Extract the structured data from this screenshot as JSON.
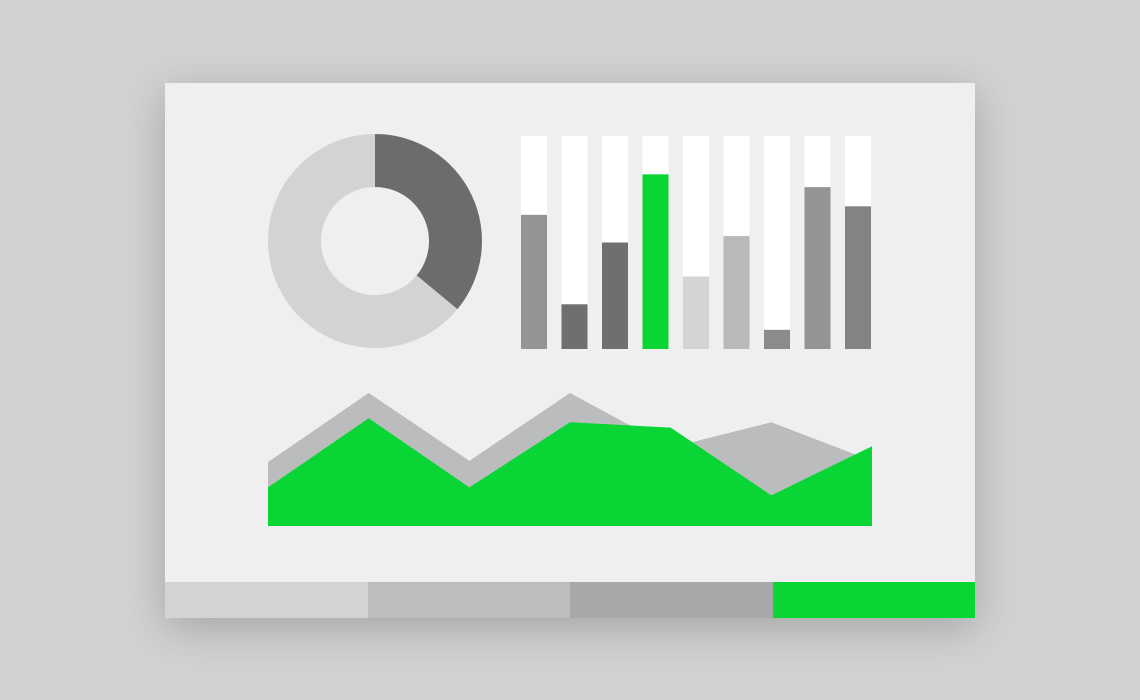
{
  "colors": {
    "page_background": "#d1d3d2",
    "panel_background": "#efefef",
    "track": "#ffffff",
    "accent": "#09d535",
    "dark_gray": "#6b6c6e",
    "light_gray": "#d2d3d3"
  },
  "chart_data": [
    {
      "type": "pie",
      "variant": "donut",
      "values": [
        36,
        64
      ],
      "colors": [
        "#6b6c6e",
        "#d2d3d3"
      ]
    },
    {
      "type": "bar",
      "ylim": [
        0,
        100
      ],
      "values": [
        63,
        21,
        50,
        82,
        34,
        53,
        9,
        76,
        67
      ],
      "colors": [
        "#939496",
        "#6e6f71",
        "#6e6f71",
        "#09d535",
        "#d3d4d4",
        "#b8b9ba",
        "#8a8b8d",
        "#939496",
        "#828385"
      ],
      "track_color": "#ffffff"
    },
    {
      "type": "area",
      "x": [
        0,
        1,
        2,
        3,
        4,
        5,
        6
      ],
      "ylim": [
        0,
        100
      ],
      "series": [
        {
          "values": [
            48,
            100,
            49,
            100,
            59,
            78,
            49
          ],
          "color": "#bbbcbd"
        },
        {
          "values": [
            29,
            81,
            29,
            78,
            74,
            23,
            60
          ],
          "color": "#09d535"
        }
      ]
    }
  ],
  "footer": {
    "segments": [
      {
        "color": "#d2d3d3"
      },
      {
        "color": "#bcbdbe"
      },
      {
        "color": "#a7a8aa"
      },
      {
        "color": "#09d535"
      }
    ]
  }
}
